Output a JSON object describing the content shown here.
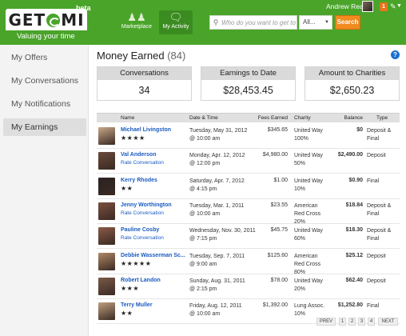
{
  "header": {
    "logo_left": "GET",
    "logo_right": "MI",
    "beta": "beta",
    "tagline": "Valuing your time",
    "nav": [
      {
        "label": "Marketplace",
        "icon": "people-icon"
      },
      {
        "label": "My Activity",
        "icon": "chat-bubbles-icon"
      }
    ],
    "search_placeholder": "Who do you want to get to kn...",
    "category": "All...",
    "search_button": "Search",
    "user_name": "Andrew Rea",
    "notification_count": "1",
    "brand_color": "#4aa42a",
    "accent_color": "#f18a1f"
  },
  "sidebar": {
    "items": [
      {
        "label": "My Offers",
        "active": false
      },
      {
        "label": "My Conversations",
        "active": false
      },
      {
        "label": "My Notifications",
        "active": false
      },
      {
        "label": "My Earnings",
        "active": true
      }
    ]
  },
  "main": {
    "title": "Money Earned",
    "title_count": "(84)",
    "stats": [
      {
        "label": "Conversations",
        "value": "34"
      },
      {
        "label": "Earnings to Date",
        "value": "$28,453.45"
      },
      {
        "label": "Amount to Charities",
        "value": "$2,650.23"
      }
    ],
    "columns": [
      "Name",
      "Date & Time",
      "Fees Earned",
      "Charity",
      "Balance",
      "Type"
    ],
    "rows": [
      {
        "name": "Michael Livingston",
        "sub": "★★★★",
        "sub_type": "stars",
        "date": "Tuesday, May 31, 2012",
        "time": "@ 10:00 am",
        "fees": "$345.65",
        "charity1": "United Way",
        "charity2": "100%",
        "charity3": "",
        "balance": "$0",
        "type1": "Deposit &",
        "type2": "Final",
        "avatar": "#c8a88a"
      },
      {
        "name": "Val Anderson",
        "sub": "Rate Conversation",
        "sub_type": "link",
        "date": "Monday, Apr. 12, 2012",
        "time": "@ 12:00 pm",
        "fees": "$4,980.00",
        "charity1": "United Way",
        "charity2": "50%",
        "charity3": "",
        "balance": "$2,490.00",
        "type1": "Deposit",
        "type2": "",
        "avatar": "#6a4a3a"
      },
      {
        "name": "Kerry Rhodes",
        "sub": "★★",
        "sub_type": "stars",
        "date": "Saturday, Apr. 7, 2012",
        "time": "@ 4:15 pm",
        "fees": "$1.00",
        "charity1": "United Way",
        "charity2": "10%",
        "charity3": "",
        "balance": "$0.90",
        "type1": "Final",
        "type2": "",
        "avatar": "#2a2222"
      },
      {
        "name": "Jenny Worthington",
        "sub": "Rate Conversation",
        "sub_type": "link",
        "date": "Tuesday, Mar. 1, 2011",
        "time": "@ 10:00 am",
        "fees": "$23.55",
        "charity1": "American",
        "charity2": "Red Cross",
        "charity3": "20%",
        "balance": "$18.84",
        "type1": "Deposit &",
        "type2": "Final",
        "avatar": "#7a5040"
      },
      {
        "name": "Pauline Cosby",
        "sub": "Rate Conversation",
        "sub_type": "link",
        "date": "Wednesday, Nov. 30, 2011",
        "time": "@ 7:15 pm",
        "fees": "$45.75",
        "charity1": "United Way",
        "charity2": "60%",
        "charity3": "",
        "balance": "$18.30",
        "type1": "Deposit &",
        "type2": "Final",
        "avatar": "#8a5a48"
      },
      {
        "name": "Debbie Wasserman Sc...",
        "sub": "★★★★★",
        "sub_type": "stars",
        "date": "Tuesday, Sep. 7, 2011",
        "time": "@ 9:00 am",
        "fees": "$125.60",
        "charity1": "American",
        "charity2": "Red Cross",
        "charity3": "80%",
        "balance": "$25.12",
        "type1": "Deposit",
        "type2": "",
        "avatar": "#b08868"
      },
      {
        "name": "Robert Landon",
        "sub": "★★★",
        "sub_type": "stars",
        "date": "Sunday, Aug. 31, 2011",
        "time": "@ 2:15 pm",
        "fees": "$78.00",
        "charity1": "United Way",
        "charity2": "20%",
        "charity3": "",
        "balance": "$62.40",
        "type1": "Deposit",
        "type2": "",
        "avatar": "#7a5a4a"
      },
      {
        "name": "Terry Muller",
        "sub": "★★",
        "sub_type": "stars",
        "date": "Friday, Aug. 12, 2011",
        "time": "@ 10:00 am",
        "fees": "$1,392.00",
        "charity1": "Lung Assoc.",
        "charity2": "10%",
        "charity3": "",
        "balance": "$1,252.80",
        "type1": "Final",
        "type2": "",
        "avatar": "#c0a080"
      }
    ],
    "pagination": [
      "PREV",
      "1",
      "2",
      "3",
      "4",
      "NEXT"
    ]
  }
}
